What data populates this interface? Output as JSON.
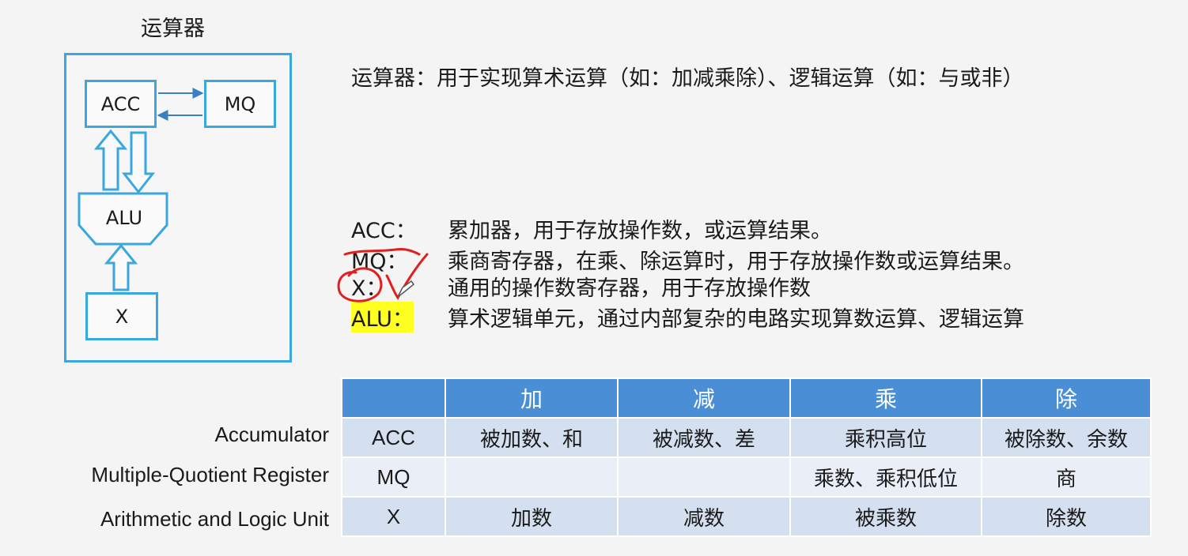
{
  "diagram": {
    "title": "运算器",
    "registers": {
      "acc": "ACC",
      "mq": "MQ",
      "alu": "ALU",
      "x": "X"
    }
  },
  "intro": "运算器：用于实现算术运算（如：加减乘除）、逻辑运算（如：与或非）",
  "definitions": [
    {
      "term": "ACC：",
      "text": "累加器，用于存放操作数，或运算结果。"
    },
    {
      "term": "MQ：",
      "text": "乘商寄存器，在乘、除运算时，用于存放操作数或运算结果。"
    },
    {
      "term": "X：",
      "text": "通用的操作数寄存器，用于存放操作数"
    },
    {
      "term": "ALU：",
      "text": "算术逻辑单元，通过内部复杂的电路实现算数运算、逻辑运算"
    }
  ],
  "table": {
    "headers": [
      "",
      "加",
      "减",
      "乘",
      "除"
    ],
    "rows": [
      {
        "label": "Accumulator",
        "cells": [
          "ACC",
          "被加数、和",
          "被减数、差",
          "乘积高位",
          "被除数、余数"
        ]
      },
      {
        "label": "Multiple-Quotient Register",
        "cells": [
          "MQ",
          "",
          "",
          "乘数、乘积低位",
          "商"
        ]
      },
      {
        "label": "Arithmetic and Logic Unit",
        "cells": [
          "X",
          "加数",
          "减数",
          "被乘数",
          "除数"
        ]
      }
    ]
  },
  "colors": {
    "accent": "#3aa7df",
    "table_header": "#4a8ed6",
    "row_dark": "#d4e0ef",
    "row_light": "#eaeff7",
    "highlight": "#ffff22",
    "annotation": "#e02020"
  }
}
